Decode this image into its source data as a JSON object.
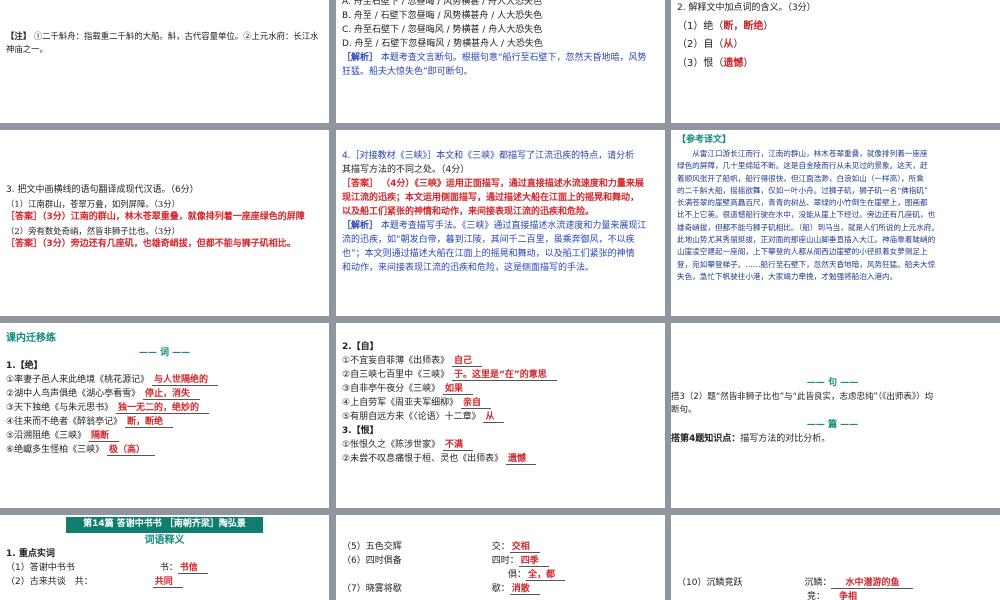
{
  "s1": {
    "note_label": "【注】",
    "note_text": "①二千斛舟：指载重二千斛的大船。斛，古代容量单位。②上元水府：长江水神庙之一。"
  },
  "s2": {
    "options": [
      "A. 舟至石壁下 / 忽昼晦 / 风势横甚 / 舟人大恐失色",
      "B. 舟至 / 石壁下忽昼晦 / 风势横甚舟 / 人大恐失色",
      "C. 舟至石壁下 / 忽昼晦风 / 势横甚 / 舟人大恐失色",
      "D. 舟至 / 石壁下忽昼晦风 / 势横甚舟人 / 大恐失色"
    ],
    "analysis_label": "［解析］",
    "analysis_lines": [
      "本题考查文言断句。根据句意“船行至石壁下，忽然天昏地暗，风势",
      "狂猛。船夫大惊失色”即可断句。"
    ]
  },
  "s3": {
    "question": "2. 解释文中加点词的含义。（3分）",
    "items": [
      {
        "pre": "（1）绝（",
        "ans": "断，断绝",
        "post": "）"
      },
      {
        "pre": "（2）自（",
        "ans": "从",
        "post": "）"
      },
      {
        "pre": "（3）恨（",
        "ans": "遗憾",
        "post": "）"
      }
    ]
  },
  "s4": {
    "question": "3. 把文中画横线的语句翻译成现代汉语。（6分）",
    "q1": "（1）江南群山，苍翠万叠，如列屏障。（3分）",
    "a1_label": "［答案］",
    "a1_lines": [
      "（3分）江南的群山，林木苍翠重叠，就像排列着一座座绿色的屏障"
    ],
    "q2": "（2）旁有数处奇峭，然皆非狮子比也。（3分）",
    "a2_label": "［答案］",
    "a2_text": "（3分）旁边还有几座矶，也雄奇峭拔，但都不能与狮子矶相比。"
  },
  "s5": {
    "question_lines": [
      "4.［对接教材《三峡》］本文和《三峡》都描写了江流迅疾的特点，请分析",
      "其描写方法的不同之处。（4分）"
    ],
    "answer_label": "［答案］",
    "answer_lines": [
      "（4分）《三峡》运用正面描写，通过直接描述水流速度和力量来展",
      "现江流的迅疾；本文运用侧面描写，通过描述大船在江面上的摇晃和舞动，",
      "以及船工们紧张的神情和动作，来间接表现江流的迅疾和危险。"
    ],
    "analysis_label": "［解析］",
    "analysis_lines": [
      "本题考查描写手法。《三峡》通过直接描述水流速度和力量来展现江",
      "流的迅疾，如“朝发白帝，暮到江陵，其间千二百里，虽乘奔御风，不以疾",
      "也”；本文则通过描述大船在江面上的摇晃和舞动，以及船工们紧张的神情",
      "和动作，来间接表现江流的迅疾和危险，这是侧面描写的手法。"
    ]
  },
  "s6": {
    "title": "【参考译文】",
    "lines": [
      "　　从雷江口游长江而行，江南的群山，林木苍翠重叠，就像排列着一座座",
      "绿色的屏障，几十里绵延不断。这是自金陵而行从未见过的景象。这天，赶",
      "着顺风张开了船帆，船行得很快，但江面浩渺，白浪如山（一样高），所乘",
      "的二千斛大船，摇摇欲舞，仅如一叶小舟。过狮子矶，狮子矶一名“佛指矶”",
      "长满苍翠的崖壁高矗百尺，青青的树丛、翠绿的小竹倒生在崖壁上，图画都",
      "比不上它美。很遗憾船行驶在水中，没能从崖上下经过。旁边还有几座矶，也",
      "雄奇峭拔，但都不能与狮子矶相比。（船）到马当，就是人们所说的上元水府。",
      "此地山势尤其秀丽挺拔，正对面的那座山山脚垂直插入大江。神庙靠着陡峭的",
      "山崖凌空建起一座阁，上下攀登的人都从阁西边崖壁的小径抓着女萝侧足上",
      "登，宛如攀登梯子。……船行至石壁下，忽然天昏地暗，风势狂猛。船夫大惊",
      "失色，急忙下帆驶往小港，大家竭力牵挽，才勉强将船泊入港内。"
    ]
  },
  "s7": {
    "section": "课内迁移练",
    "subheading": "—— 词 ——",
    "heading_label": "1.【绝】",
    "items": [
      {
        "text": "①率妻子邑人来此绝境《桃花源记》",
        "ans": "与人世隔绝的"
      },
      {
        "text": "②湖中人鸟声俱绝《湖心亭看雪》",
        "ans": "停止，消失"
      },
      {
        "text": "③天下独绝《与朱元思书》",
        "ans": "独一无二的，绝妙的"
      },
      {
        "text": "④往来而不绝者《醉翁亭记》",
        "ans": "断，断绝"
      },
      {
        "text": "⑤沿溯阻绝《三峡》",
        "ans": "隔断"
      },
      {
        "text": "⑥绝巘多生怪柏《三峡》",
        "ans": "极（高）"
      }
    ]
  },
  "s8": {
    "heading2": "2.【自】",
    "items2": [
      {
        "text": "①不宜妄自菲薄《出师表》",
        "ans": "自己"
      },
      {
        "text": "②自三峡七百里中《三峡》",
        "ans": "于。这里是“在”的意思"
      },
      {
        "text": "③自非亭午夜分《三峡》",
        "ans": "如果"
      },
      {
        "text": "④上自劳军《周亚夫军细柳》",
        "ans": "亲自"
      },
      {
        "text": "⑤有朋自远方来《〈论语〉十二章》",
        "ans": "从"
      }
    ],
    "heading3": "3.【恨】",
    "items3": [
      {
        "text": "①怅恨久之《陈涉世家》",
        "ans": "不满"
      },
      {
        "text": "②未尝不叹息痛恨于桓、灵也《出师表》",
        "ans": "遗憾"
      }
    ]
  },
  "s9": {
    "subheading1": "—— 句 ——",
    "text_lines": [
      "搭3（2）题“然皆非狮子比也”与“此皆良实，志虑忠纯”（《出师表》）均",
      "断句。"
    ],
    "subheading2": "—— 篇 ——",
    "text2_label": "搭第4题知识点：",
    "text2": "描写方法的对比分析。"
  },
  "s10": {
    "banner": "第14篇  答谢中书书  ［南朝齐梁］陶弘景",
    "title": "词语释义",
    "sub": "1. 重点实词",
    "row1_text": "（1）答谢中书书",
    "row1_key": "书：",
    "row1_ans": "书信",
    "row2_text": "（2）古来共谈　共：",
    "row2_ans": "共同"
  },
  "s11": {
    "row1_text": "（5）五色交辉",
    "row1_key": "交：",
    "row1_ans": "交相",
    "row2_text": "（6）四时俱备",
    "row2_key": "四时：",
    "row2_ans": "四季",
    "row3_key": "俱：",
    "row3_ans": "全，都",
    "row4_text": "（7）晓雾将歇",
    "row4_key": "歇：",
    "row4_ans": "消散"
  },
  "s12": {
    "row1_text": "（10）沉鳞竞跃",
    "row1_key": "沉鳞：",
    "row1_ans": "水中潜游的鱼",
    "row2_key": "竞：",
    "row2_ans": "争相"
  }
}
